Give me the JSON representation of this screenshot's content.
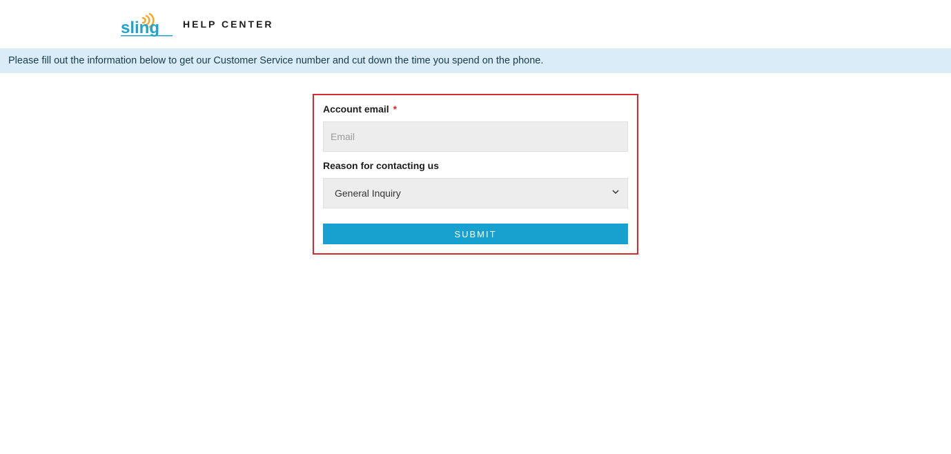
{
  "header": {
    "brand": "sling",
    "title": "HELP CENTER"
  },
  "banner": {
    "text": "Please fill out the information below to get our Customer Service number and cut down the time you spend on the phone."
  },
  "form": {
    "email_label": "Account email",
    "required_mark": "*",
    "email_placeholder": "Email",
    "email_value": "",
    "reason_label": "Reason for contacting us",
    "reason_selected": "General Inquiry",
    "submit_label": "SUBMIT"
  }
}
